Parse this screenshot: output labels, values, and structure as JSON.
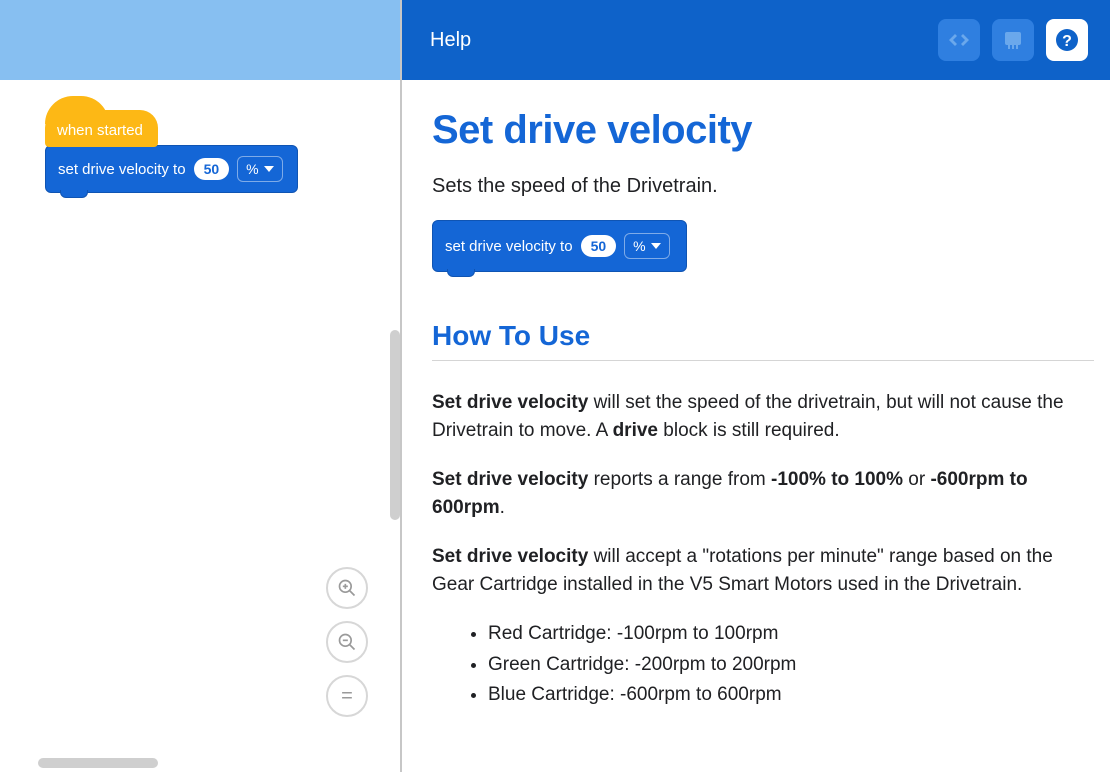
{
  "workspace": {
    "hat_label": "when started",
    "set_block": {
      "prefix": "set drive velocity to",
      "value": "50",
      "unit": "%"
    }
  },
  "help": {
    "header_title": "Help",
    "title": "Set drive velocity",
    "intro": "Sets the speed of the Drivetrain.",
    "example_block": {
      "prefix": "set drive velocity to",
      "value": "50",
      "unit": "%"
    },
    "howto_heading": "How To Use",
    "p1": {
      "b1": "Set drive velocity",
      "t1": " will set the speed of the drivetrain, but will not cause the Drivetrain to move. A ",
      "b2": "drive",
      "t2": " block is still required."
    },
    "p2": {
      "b1": "Set drive velocity",
      "t1": " reports a range from ",
      "b2": "-100% to 100%",
      "t2": " or ",
      "b3": "-600rpm to 600rpm",
      "t3": "."
    },
    "p3": {
      "b1": "Set drive velocity",
      "t1": " will accept a \"rotations per minute\" range based on the Gear Cartridge installed in the V5 Smart Motors used in the Drivetrain."
    },
    "cartridges": [
      "Red Cartridge: -100rpm to 100rpm",
      "Green Cartridge: -200rpm to 200rpm",
      "Blue Cartridge: -600rpm to 600rpm"
    ]
  }
}
